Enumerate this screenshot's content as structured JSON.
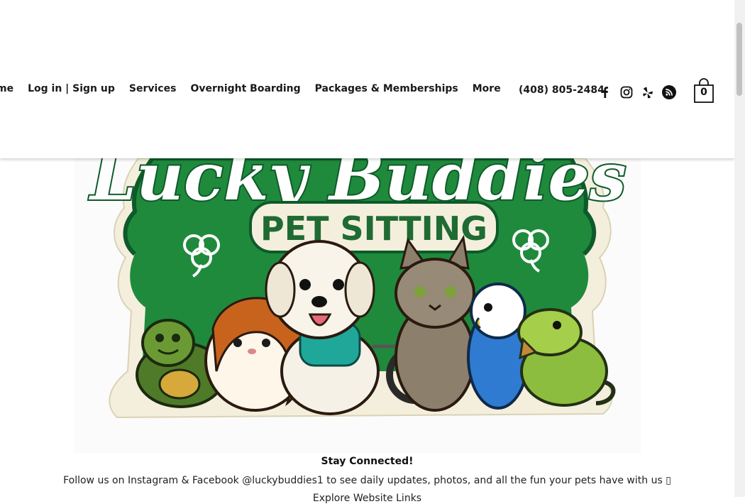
{
  "nav": {
    "items": [
      {
        "label": "me"
      },
      {
        "label": "Log in | Sign up"
      },
      {
        "label": "Services"
      },
      {
        "label": "Overnight Boarding"
      },
      {
        "label": "Packages & Memberships"
      },
      {
        "label": "More"
      }
    ]
  },
  "contact": {
    "phone": "(408) 805-2484"
  },
  "social": {
    "icons": [
      "facebook-icon",
      "instagram-icon",
      "yelp-icon",
      "rss-icon"
    ]
  },
  "cart": {
    "count": "0"
  },
  "hero": {
    "logo_title": "Lucky Buddies",
    "logo_subtitle": "PET SITTING",
    "colors": {
      "green": "#1f8a3c",
      "dark_green": "#0e5a2a",
      "cream": "#f4efdc"
    }
  },
  "main": {
    "heading": "Stay Connected!",
    "body": "Follow us on Instagram & Facebook @luckybuddies1 to see daily updates, photos, and all the fun your pets have with us ▯",
    "cutoff_line": "Explore Website Links"
  }
}
